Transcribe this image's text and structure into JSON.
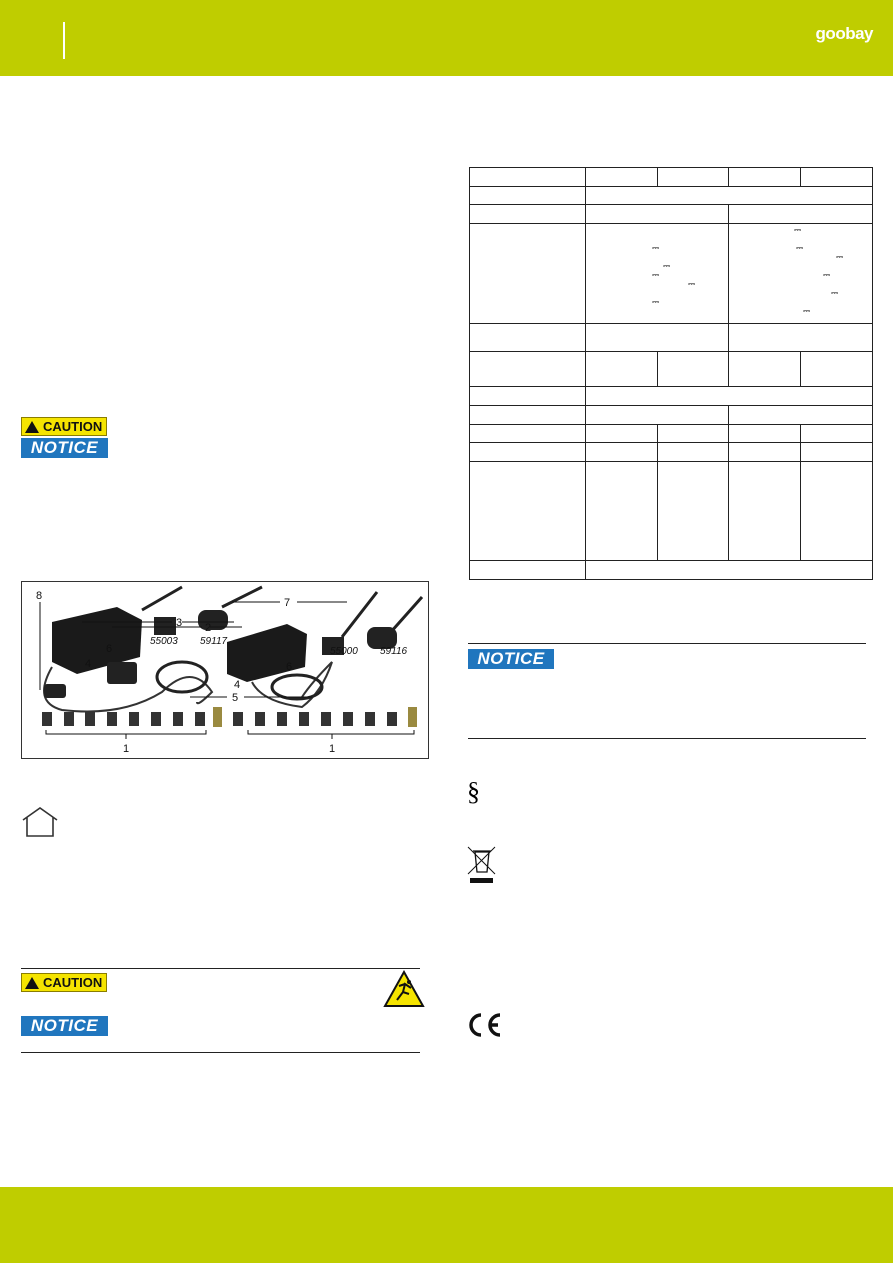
{
  "header": {
    "logo": "goobay",
    "color": "#bfcd00"
  },
  "left": {
    "caution_top": "CAUTION",
    "notice_top": "NOTICE",
    "caution_bottom": "CAUTION",
    "notice_bottom": "NOTICE"
  },
  "figure": {
    "callouts": [
      "8",
      "7",
      "3",
      "2",
      "6",
      "4",
      "5",
      "6",
      "4",
      "1",
      "1"
    ],
    "models": [
      "55003",
      "59117",
      "55000",
      "59116"
    ]
  },
  "right": {
    "notice": "NOTICE",
    "dc_symbol": "⎓"
  },
  "icons": [
    "home-icon",
    "caution-sign",
    "slip-hazard-icon",
    "notice-sign",
    "paragraph-icon",
    "weee-bin-icon",
    "ce-mark-icon"
  ],
  "colors": {
    "brand": "#bfcd00",
    "notice": "#2076be",
    "caution": "#f5e400"
  }
}
